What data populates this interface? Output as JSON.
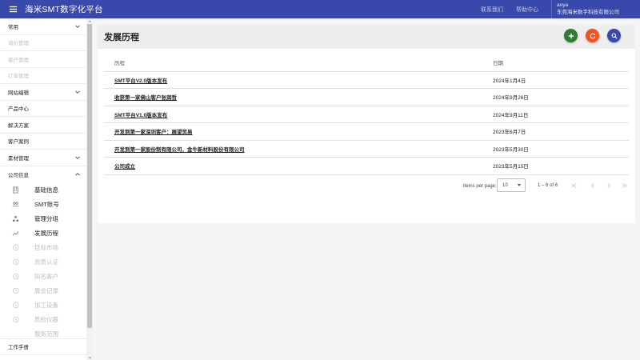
{
  "app": {
    "title": "海米SMT数字化平台",
    "top_links": [
      "联系我们",
      "帮助中心"
    ],
    "user": {
      "name": "aoya",
      "company": "东莞海米数字科技有限公司"
    }
  },
  "sidebar": {
    "rows_top": [
      {
        "label": "常用",
        "chevron": "down",
        "muted": false
      },
      {
        "label": "询价管理",
        "muted": true
      },
      {
        "label": "客户管理",
        "muted": true
      },
      {
        "label": "订单管理",
        "muted": true
      },
      {
        "label": "网站编辑",
        "chevron": "down",
        "muted": false
      },
      {
        "label": "产品中心",
        "muted": false
      },
      {
        "label": "解决方案",
        "muted": false
      },
      {
        "label": "客户案例",
        "muted": false
      },
      {
        "label": "素材管理",
        "chevron": "down",
        "muted": false
      },
      {
        "label": "公司信息",
        "chevron": "up",
        "muted": false
      }
    ],
    "sub_items": [
      {
        "label": "基础信息",
        "icon": "building-icon",
        "muted": false
      },
      {
        "label": "SMT账号",
        "icon": "users-icon",
        "muted": false
      },
      {
        "label": "管理分组",
        "icon": "hierarchy-icon",
        "muted": false
      },
      {
        "label": "发展历程",
        "icon": "trend-icon",
        "muted": false
      },
      {
        "label": "目标市场",
        "icon": "history-icon",
        "muted": true
      },
      {
        "label": "资质认证",
        "icon": "history-icon",
        "muted": true
      },
      {
        "label": "知名客户",
        "icon": "history-icon",
        "muted": true
      },
      {
        "label": "展会记录",
        "icon": "history-icon",
        "muted": true
      },
      {
        "label": "加工设备",
        "icon": "history-icon",
        "muted": true
      },
      {
        "label": "质检仪器",
        "icon": "history-icon",
        "muted": true
      },
      {
        "label": "服务范围",
        "icon": "",
        "muted": true
      }
    ],
    "bottom_row": {
      "label": "工作手册"
    }
  },
  "main": {
    "page_title": "发展历程",
    "actions": {
      "add": "add-icon",
      "refresh": "refresh-icon",
      "search": "search-icon"
    },
    "table": {
      "headers": [
        "历程",
        "日期"
      ],
      "rows": [
        {
          "title": "SMT平台V2.0版本发布",
          "date": "2024年1月4日"
        },
        {
          "title": "收获第一家佛山客户张润哲",
          "date": "2024年9月26日"
        },
        {
          "title": "SMT平台V1.0版本发布",
          "date": "2024年9月11日"
        },
        {
          "title": "开发到第一家深圳客户：展望贸易",
          "date": "2023年6月7日"
        },
        {
          "title": "开发到第一家股份制有限公司，金牛新材料股份有限公司",
          "date": "2023年5月30日"
        },
        {
          "title": "公司成立",
          "date": "2023年5月15日"
        }
      ]
    },
    "pager": {
      "label": "Items per page:",
      "page_size": "10",
      "range": "1 – 6 of 6"
    }
  },
  "colors": {
    "primary": "#3949ab",
    "add": "#2e7d32",
    "refresh": "#f4511e",
    "search": "#3949ab"
  }
}
